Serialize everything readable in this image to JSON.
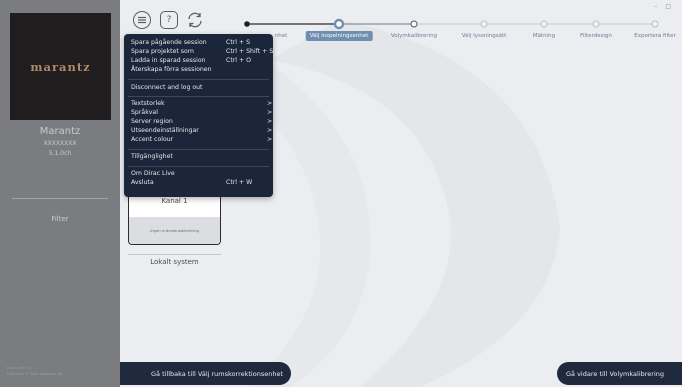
{
  "sidebar": {
    "logo": "marantz",
    "device_name": "Marantz",
    "device_serial": "XXXXXXXX",
    "device_config": "5.1.0ch",
    "filter_label": "Filter",
    "version": "Dirac Live 3.x",
    "copyright": "Copyright © Dirac Research AB"
  },
  "steps": [
    {
      "label": "Välj rumskorrektionsenhet",
      "visible_label": "nhet",
      "state": "done"
    },
    {
      "label": "Välj inspelningsenhet",
      "state": "active"
    },
    {
      "label": "Volymkalibrering",
      "state": "next"
    },
    {
      "label": "Välj lyssningsätt",
      "state": "future"
    },
    {
      "label": "Mätning",
      "state": "future"
    },
    {
      "label": "Filterdesign",
      "state": "future"
    },
    {
      "label": "Exportera filter",
      "state": "future"
    }
  ],
  "window_controls": "– □",
  "help_label": "?",
  "card": {
    "title": "Kanal 1",
    "calibration": "Ingen mikrofonkalibrering"
  },
  "local_system": "Lokalt system",
  "nav": {
    "back": "Gå tillbaka till Välj rumskorrektionsenhet",
    "next": "Gå vidare till Volymkalibrering"
  },
  "menu": {
    "items": [
      {
        "label": "Spara pågående session",
        "shortcut": "Ctrl + S"
      },
      {
        "label": "Spara projektet som",
        "shortcut": "Ctrl + Shift + S"
      },
      {
        "label": "Ladda in sparad session",
        "shortcut": "Ctrl + O"
      },
      {
        "label": "Återskapa förra sessionen"
      },
      {
        "label": "Disconnect and log out"
      },
      {
        "label": "Textstorlek",
        "arrow": ">"
      },
      {
        "label": "Språkval",
        "arrow": ">"
      },
      {
        "label": "Server region",
        "arrow": ">"
      },
      {
        "label": "Utseendeinställningar",
        "arrow": ">"
      },
      {
        "label": "Accent colour",
        "arrow": ">"
      },
      {
        "label": "Tillgänglighet"
      },
      {
        "label": "Om Dirac Live"
      },
      {
        "label": "Avsluta",
        "shortcut": "Ctrl + W"
      }
    ]
  },
  "colors": {
    "sidebar": "#7b7c80",
    "menu_bg": "#1c263a",
    "active_step": "#6f8fb1",
    "nav_button": "#1f2a3f",
    "logo_text": "#b18a6a"
  }
}
